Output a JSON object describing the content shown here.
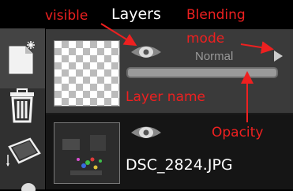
{
  "panel": {
    "title": "Layers"
  },
  "layers": [
    {
      "blend_mode": "Normal",
      "opacity_fraction": 0.99,
      "thumbnail": "transparent-checkerboard"
    },
    {
      "name": "DSC_2824.JPG",
      "thumbnail": "photo"
    }
  ],
  "annotations": {
    "visible": "visible",
    "blending_line1": "Blending",
    "blending_line2": "mode",
    "layer_name": "Layer name",
    "opacity": "Opacity"
  },
  "colors": {
    "annotation": "#ee2020",
    "background": "#000000",
    "sidebar": "#303030",
    "selected_row": "#3a3a3a"
  },
  "icons": [
    "new-layer-icon",
    "trash-icon",
    "tablet-icon",
    "eye-icon"
  ]
}
